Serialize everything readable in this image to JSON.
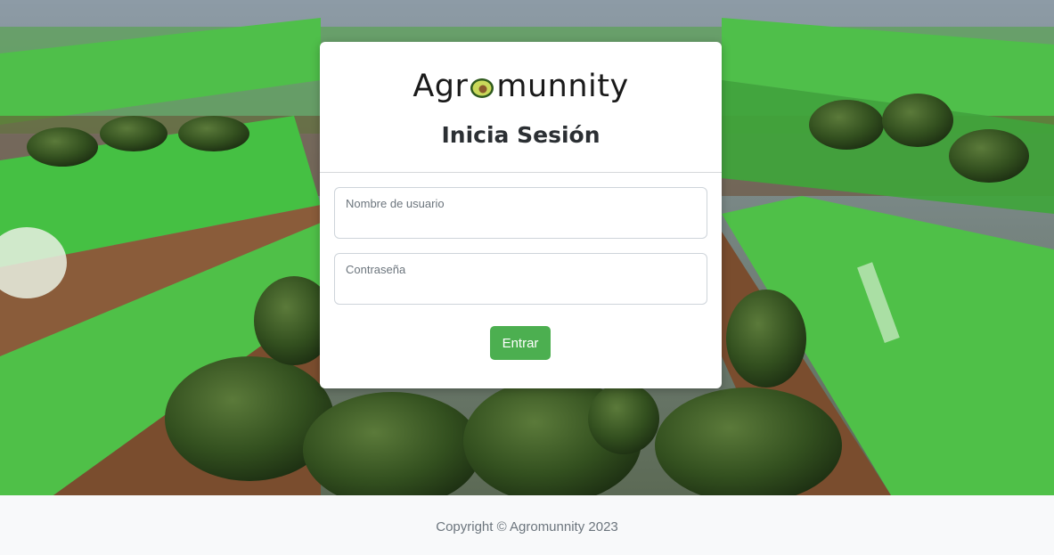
{
  "brand": {
    "name_prefix": "Agr",
    "name_suffix": "munnity",
    "accent_color": "#4caf50"
  },
  "login": {
    "title": "Inicia Sesión",
    "username_label": "Nombre de usuario",
    "username_value": "",
    "password_label": "Contraseña",
    "password_value": "",
    "submit_label": "Entrar"
  },
  "footer": {
    "copyright": "Copyright © Agromunnity 2023"
  }
}
